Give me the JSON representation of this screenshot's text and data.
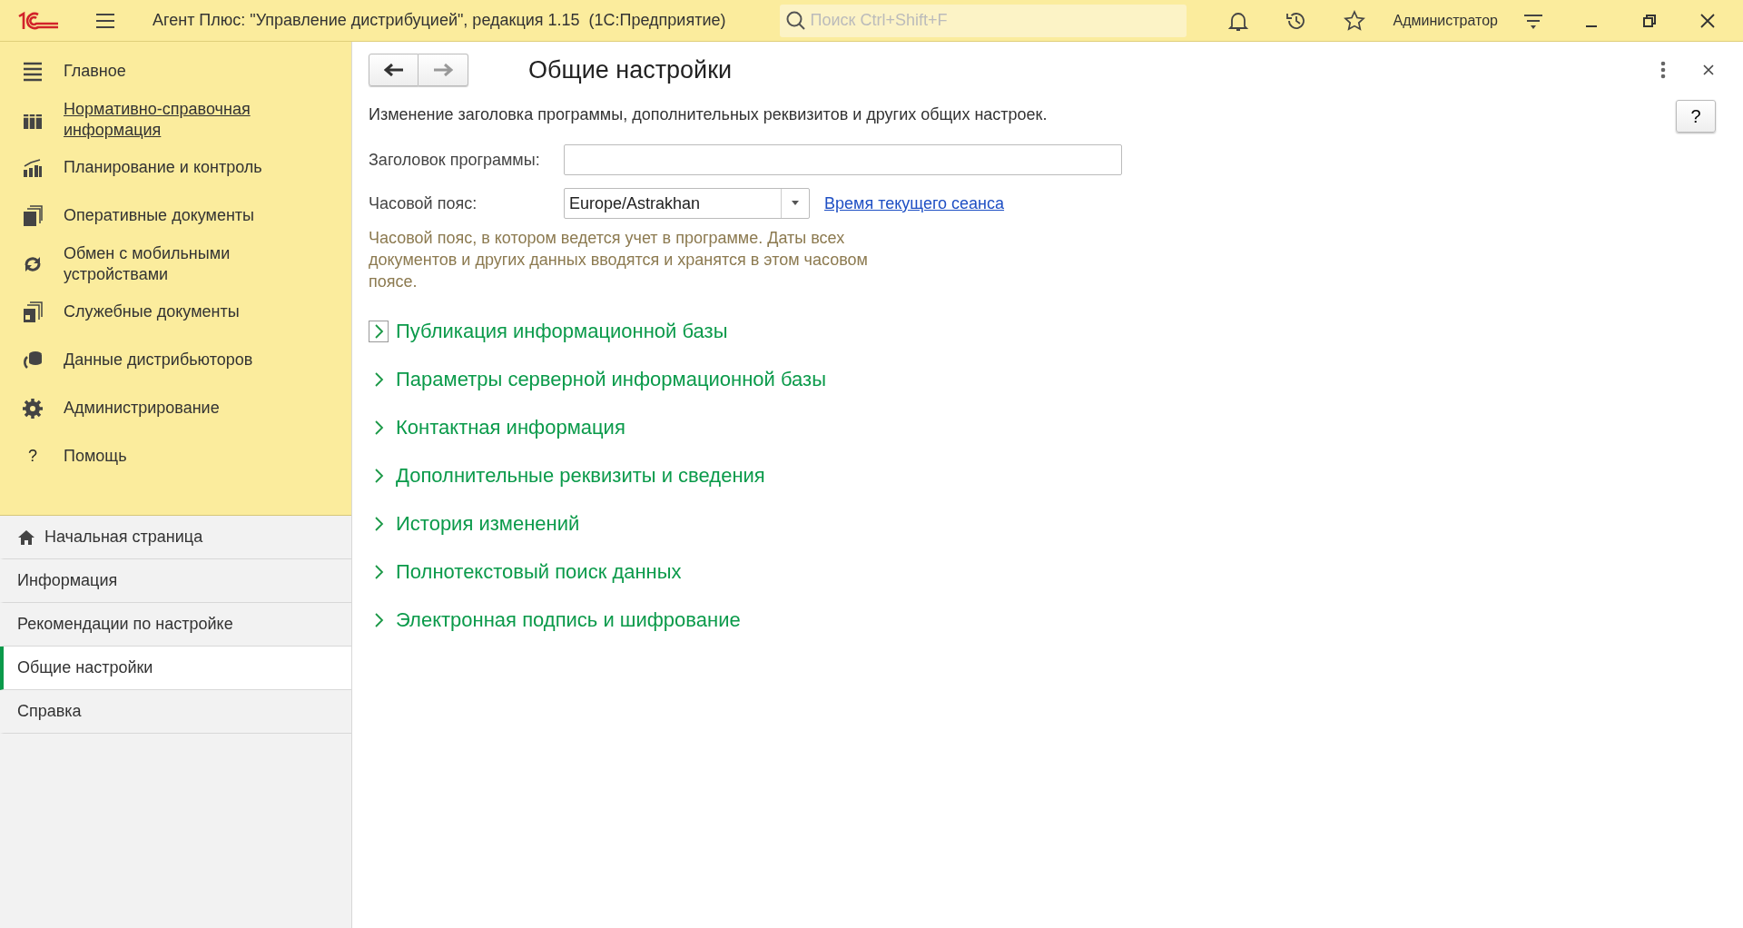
{
  "window": {
    "title": "Агент Плюс: \"Управление дистрибуцией\", редакция 1.15  (1С:Предприятие)",
    "search": {
      "placeholder": "Поиск Ctrl+Shift+F"
    },
    "user": "Администратор"
  },
  "sections": [
    {
      "label": "Главное",
      "hovered": false
    },
    {
      "label": "Нормативно-справочная информация",
      "hovered": true
    },
    {
      "label": "Планирование и контроль",
      "hovered": false
    },
    {
      "label": "Оперативные документы",
      "hovered": false
    },
    {
      "label": "Обмен с мобильными устройствами",
      "hovered": false
    },
    {
      "label": "Служебные документы",
      "hovered": false
    },
    {
      "label": "Данные дистрибьюторов",
      "hovered": false
    },
    {
      "label": "Администрирование",
      "hovered": false
    },
    {
      "label": "Помощь",
      "hovered": false,
      "glyph": "?"
    }
  ],
  "open_pages": [
    {
      "label": "Начальная страница",
      "kind": "home",
      "selected": false
    },
    {
      "label": "Информация",
      "kind": "page",
      "selected": false
    },
    {
      "label": "Рекомендации по настройке",
      "kind": "page",
      "selected": false
    },
    {
      "label": "Общие настройки",
      "kind": "page",
      "selected": true
    },
    {
      "label": "Справка",
      "kind": "page",
      "selected": false
    }
  ],
  "form": {
    "title": "Общие настройки",
    "help": "?",
    "description": "Изменение заголовка программы, дополнительных реквизитов и других общих настроек.",
    "fields": [
      {
        "label": "Заголовок программы:",
        "kind": "text"
      },
      {
        "label": "Часовой пояс:",
        "kind": "combo",
        "value": "Europe/Astrakhan",
        "link": "Время текущего сеанса"
      }
    ],
    "hint": "Часовой пояс, в котором ведется учет в программе. Даты всех документов и других данных вводятся и хранятся в этом часовом поясе.",
    "groups": [
      {
        "label": "Публикация информационной базы",
        "expanded": false,
        "focused": true
      },
      {
        "label": "Параметры серверной информационной базы",
        "expanded": false,
        "focused": false
      },
      {
        "label": "Контактная информация",
        "expanded": false,
        "focused": false
      },
      {
        "label": "Дополнительные реквизиты и сведения",
        "expanded": false,
        "focused": false
      },
      {
        "label": "История изменений",
        "expanded": false,
        "focused": false
      },
      {
        "label": "Полнотекстовый поиск данных",
        "expanded": false,
        "focused": false
      },
      {
        "label": "Электронная подпись и шифрование",
        "expanded": false,
        "focused": false
      }
    ]
  }
}
